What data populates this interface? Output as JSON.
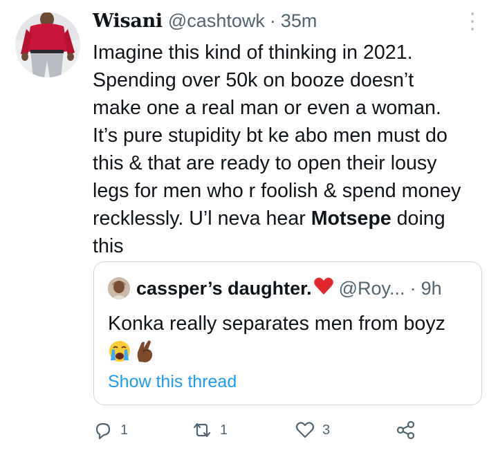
{
  "tweet": {
    "author_name": "Wisani",
    "handle": "@cashtowk",
    "separator": "·",
    "time": "35m",
    "text_lines": [
      "Imagine this kind of thinking in 2021.",
      "Spending over 50k on booze doesn’t",
      "make one a real man or even a woman.",
      "It’s pure stupidity bt ke abo men must do",
      "this & that are ready to open their lousy",
      "legs for men who r foolish & spend money",
      "recklessly. U’l neva hear "
    ],
    "mention_bold": "Motsepe",
    "tail_line_1": " doing",
    "tail_line_2": "this"
  },
  "quote": {
    "author_name": "cassper’s daughter.",
    "handle": "@Roy...",
    "separator": "·",
    "time": "9h",
    "text": "Konka really separates men from boyz",
    "show_thread": "Show this thread"
  },
  "actions": {
    "reply_count": "1",
    "retweet_count": "1",
    "like_count": "3"
  },
  "icons": {
    "more": "more-vertical-icon",
    "reply": "reply-icon",
    "retweet": "retweet-icon",
    "like": "like-icon",
    "share": "share-icon"
  },
  "colors": {
    "text": "#0f1419",
    "secondary": "#536471",
    "link": "#1d9bf0",
    "border": "#cfd9de"
  }
}
